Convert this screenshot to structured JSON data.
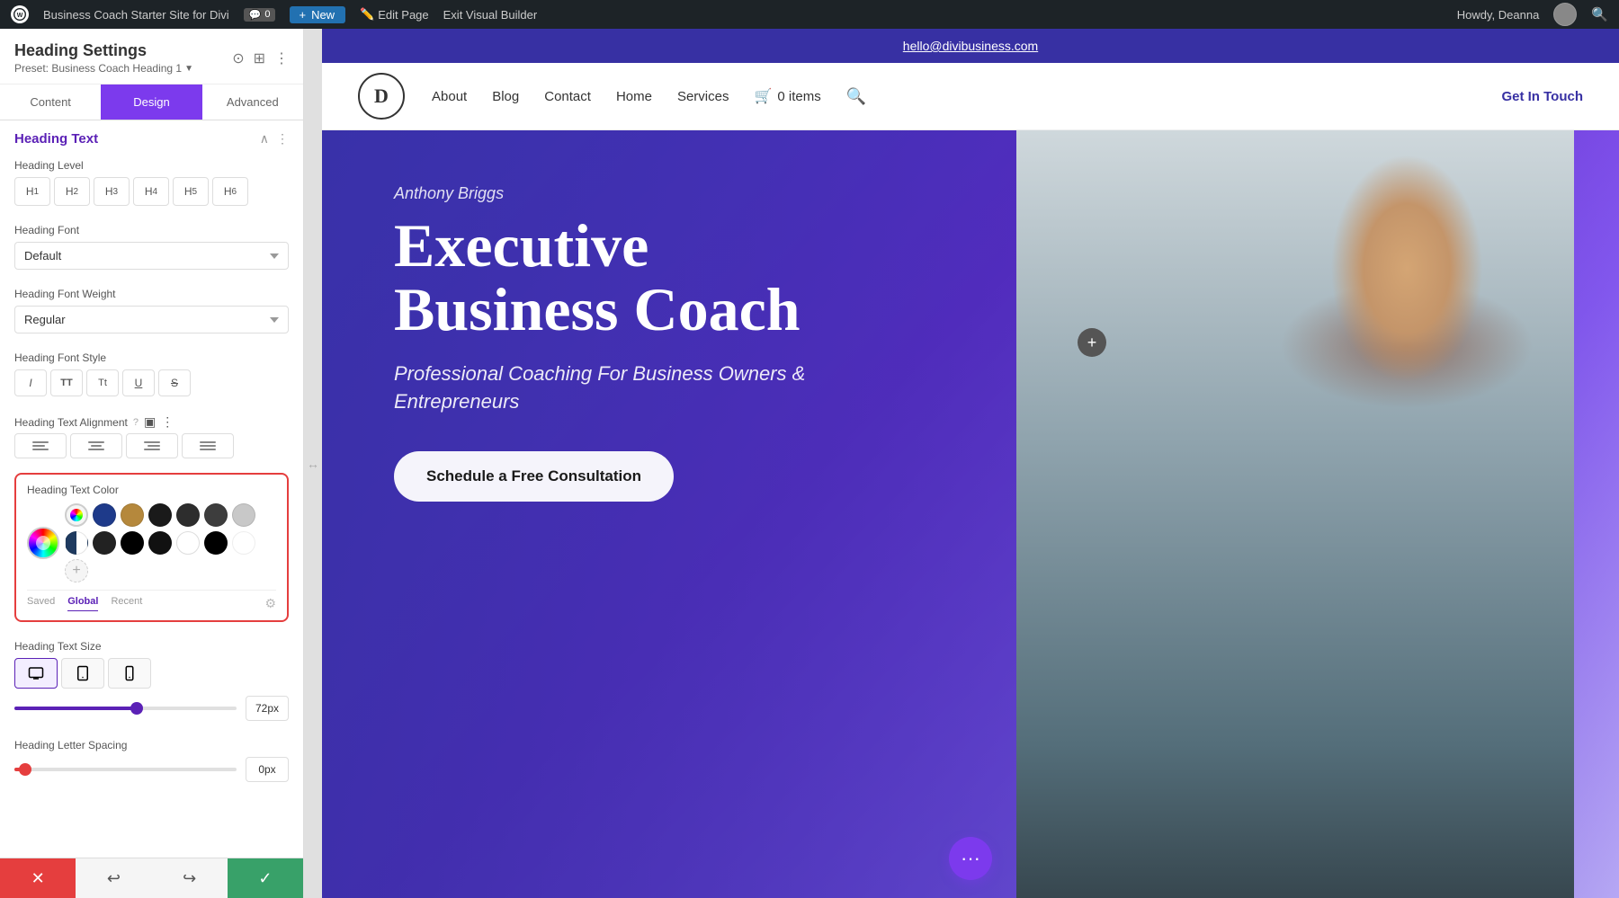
{
  "wp_admin": {
    "logo": "W",
    "site_name": "Business Coach Starter Site for Divi",
    "comments_label": "0",
    "new_label": "New",
    "edit_page": "Edit Page",
    "exit_builder": "Exit Visual Builder",
    "howdy": "Howdy, Deanna",
    "search_icon": "🔍"
  },
  "sidebar": {
    "title": "Heading Settings",
    "preset": "Preset: Business Coach Heading 1",
    "preset_arrow": "▼",
    "tabs": {
      "content": "Content",
      "design": "Design",
      "advanced": "Advanced"
    },
    "active_tab": "Design",
    "section_title": "Heading Text",
    "settings": {
      "heading_level": "Heading Level",
      "h_buttons": [
        "H₁",
        "H₂",
        "H₃",
        "H₄",
        "H₅",
        "H₆"
      ],
      "heading_font": "Heading Font",
      "font_default": "Default",
      "heading_font_weight": "Heading Font Weight",
      "font_weight_default": "Regular",
      "heading_font_style": "Heading Font Style",
      "heading_text_alignment": "Heading Text Alignment",
      "heading_text_color": "Heading Text Color",
      "color_tabs": {
        "saved": "Saved",
        "global": "Global",
        "recent": "Recent"
      },
      "active_color_tab": "Global",
      "heading_text_size": "Heading Text Size",
      "size_value": "72px",
      "size_fill_percent": 55,
      "heading_letter_spacing": "Heading Letter Spacing",
      "spacing_value": "0px",
      "spacing_fill_percent": 5
    },
    "colors": [
      {
        "value": "#1e3a5f",
        "type": "solid"
      },
      {
        "value": "#c4953a",
        "type": "solid"
      },
      {
        "value": "#1a1a1a",
        "type": "solid"
      },
      {
        "value": "#2a2a2a",
        "type": "solid"
      },
      {
        "value": "#3a3a3a",
        "type": "solid"
      },
      {
        "value": "#d0d0d0",
        "type": "solid"
      },
      {
        "value": "#111111",
        "type": "half"
      },
      {
        "value": "#222222",
        "type": "solid"
      },
      {
        "value": "#000000",
        "type": "solid"
      },
      {
        "value": "#111",
        "type": "solid"
      },
      {
        "value": "#ffffff",
        "type": "solid"
      }
    ],
    "bottom_toolbar": {
      "cancel": "✕",
      "undo": "↩",
      "redo": "↪",
      "save": "✓"
    }
  },
  "email_bar": {
    "email": "hello@divibusiness.com"
  },
  "site_header": {
    "logo_letter": "D",
    "nav_links": [
      "About",
      "Blog",
      "Contact",
      "Home",
      "Services"
    ],
    "cart_icon": "🛒",
    "cart_count": "0 items",
    "cta_label": "Get In Touch"
  },
  "hero": {
    "name": "Anthony Briggs",
    "title": "Executive Business Coach",
    "subtitle": "Professional Coaching For Business Owners & Entrepreneurs",
    "cta_label": "Schedule a Free Consultation"
  },
  "footer_fab": {
    "icon": "···"
  }
}
